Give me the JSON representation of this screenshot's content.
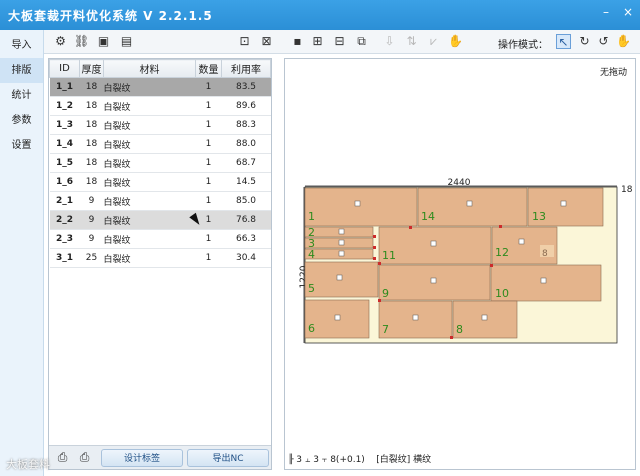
{
  "app": {
    "title": "大板套裁开料优化系统 V 2.2.1.5"
  },
  "window_buttons": {
    "minimize": "–",
    "close": "×"
  },
  "sidebar": {
    "items": [
      {
        "label": "导入",
        "active": false
      },
      {
        "label": "排版",
        "active": true
      },
      {
        "label": "统计",
        "active": false
      },
      {
        "label": "参数",
        "active": false
      },
      {
        "label": "设置",
        "active": false
      }
    ]
  },
  "toolbar": {
    "mode_label": "操作模式："
  },
  "table": {
    "headers": [
      "ID",
      "厚度",
      "材料",
      "数量",
      "利用率"
    ],
    "rows": [
      {
        "id": "1_1",
        "thickness": "18",
        "material": "白裂纹",
        "qty": "1",
        "rate": "83.5"
      },
      {
        "id": "1_2",
        "thickness": "18",
        "material": "白裂纹",
        "qty": "1",
        "rate": "89.6"
      },
      {
        "id": "1_3",
        "thickness": "18",
        "material": "白裂纹",
        "qty": "1",
        "rate": "88.3"
      },
      {
        "id": "1_4",
        "thickness": "18",
        "material": "白裂纹",
        "qty": "1",
        "rate": "88.0"
      },
      {
        "id": "1_5",
        "thickness": "18",
        "material": "白裂纹",
        "qty": "1",
        "rate": "68.7"
      },
      {
        "id": "1_6",
        "thickness": "18",
        "material": "白裂纹",
        "qty": "1",
        "rate": "14.5"
      },
      {
        "id": "2_1",
        "thickness": "9",
        "material": "白裂纹",
        "qty": "1",
        "rate": "85.0"
      },
      {
        "id": "2_2",
        "thickness": "9",
        "material": "白裂纹",
        "qty": "1",
        "rate": "76.8"
      },
      {
        "id": "2_3",
        "thickness": "9",
        "material": "白裂纹",
        "qty": "1",
        "rate": "66.3"
      },
      {
        "id": "3_1",
        "thickness": "25",
        "material": "白裂纹",
        "qty": "1",
        "rate": "30.4"
      }
    ]
  },
  "buttons": {
    "design_label": "设计标签",
    "export_nc": "导出NC"
  },
  "canvas": {
    "no_drag": "无拖动",
    "board_width": "2440",
    "board_height": "1220",
    "thickness": "18",
    "part_numbers": [
      "1",
      "2",
      "3",
      "4",
      "5",
      "6",
      "7",
      "8",
      "9",
      "10",
      "11",
      "12",
      "13",
      "14"
    ],
    "offcut_label": "8"
  },
  "status": {
    "text1": "3",
    "text2": "3",
    "text3": "8(+0.1)",
    "material": "[白裂纹]",
    "grain": "横纹"
  },
  "colors": {
    "title_bar": "#2b8fd6",
    "part_fill": "#e4b48c",
    "offcut_fill": "#fbf6d8",
    "part_number": "#2e8b1e"
  },
  "watermark": "大板套料"
}
